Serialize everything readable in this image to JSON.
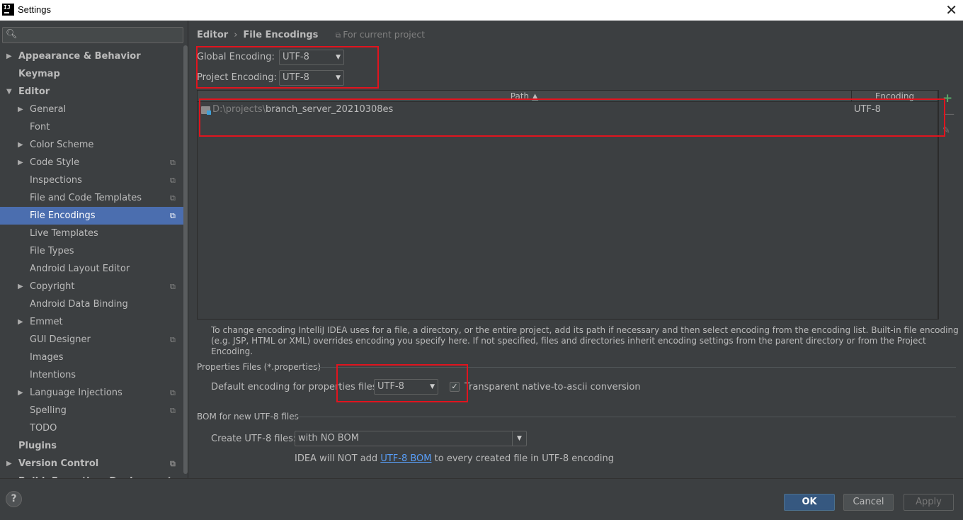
{
  "window": {
    "app_icon": "IJ",
    "title": "Settings",
    "close_icon": "✕"
  },
  "sidebar": {
    "search_placeholder": "",
    "items": [
      {
        "label": "Appearance & Behavior",
        "bold": true,
        "level": 0,
        "expandable": true,
        "expanded": false,
        "project": false
      },
      {
        "label": "Keymap",
        "bold": true,
        "level": 0,
        "expandable": false,
        "project": false
      },
      {
        "label": "Editor",
        "bold": true,
        "level": 0,
        "expandable": true,
        "expanded": true,
        "project": false
      },
      {
        "label": "General",
        "level": 1,
        "expandable": true,
        "expanded": false,
        "project": false
      },
      {
        "label": "Font",
        "level": 1,
        "expandable": false,
        "project": false
      },
      {
        "label": "Color Scheme",
        "level": 1,
        "expandable": true,
        "expanded": false,
        "project": false
      },
      {
        "label": "Code Style",
        "level": 1,
        "expandable": true,
        "expanded": false,
        "project": true
      },
      {
        "label": "Inspections",
        "level": 1,
        "expandable": false,
        "project": true
      },
      {
        "label": "File and Code Templates",
        "level": 1,
        "expandable": false,
        "project": true
      },
      {
        "label": "File Encodings",
        "level": 1,
        "expandable": false,
        "project": true,
        "selected": true
      },
      {
        "label": "Live Templates",
        "level": 1,
        "expandable": false,
        "project": false
      },
      {
        "label": "File Types",
        "level": 1,
        "expandable": false,
        "project": false
      },
      {
        "label": "Android Layout Editor",
        "level": 1,
        "expandable": false,
        "project": false
      },
      {
        "label": "Copyright",
        "level": 1,
        "expandable": true,
        "expanded": false,
        "project": true
      },
      {
        "label": "Android Data Binding",
        "level": 1,
        "expandable": false,
        "project": false
      },
      {
        "label": "Emmet",
        "level": 1,
        "expandable": true,
        "expanded": false,
        "project": false
      },
      {
        "label": "GUI Designer",
        "level": 1,
        "expandable": false,
        "project": true
      },
      {
        "label": "Images",
        "level": 1,
        "expandable": false,
        "project": false
      },
      {
        "label": "Intentions",
        "level": 1,
        "expandable": false,
        "project": false
      },
      {
        "label": "Language Injections",
        "level": 1,
        "expandable": true,
        "expanded": false,
        "project": true
      },
      {
        "label": "Spelling",
        "level": 1,
        "expandable": false,
        "project": true
      },
      {
        "label": "TODO",
        "level": 1,
        "expandable": false,
        "project": false
      },
      {
        "label": "Plugins",
        "bold": true,
        "level": 0,
        "expandable": false,
        "project": false
      },
      {
        "label": "Version Control",
        "bold": true,
        "level": 0,
        "expandable": true,
        "expanded": false,
        "project": true
      },
      {
        "label": "Build, Execution, Deployment",
        "bold": true,
        "level": 0,
        "expandable": true,
        "expanded": false,
        "project": false
      }
    ]
  },
  "breadcrumb": {
    "parent": "Editor",
    "separator": "›",
    "current": "File Encodings",
    "scope": "For current project"
  },
  "encodings": {
    "global_label": "Global Encoding:",
    "global_value": "UTF-8",
    "project_label": "Project Encoding:",
    "project_value": "UTF-8"
  },
  "table": {
    "columns": [
      "Path ▲",
      "Encoding"
    ],
    "rows": [
      {
        "path_prefix": "D:\\projects\\",
        "path_name": "branch_server_20210308es",
        "encoding": "UTF-8"
      }
    ],
    "add_icon": "+",
    "remove_icon": "—",
    "edit_icon": "✎"
  },
  "description": "To change encoding IntelliJ IDEA uses for a file, a directory, or the entire project, add its path if necessary and then select encoding from the encoding list. Built-in file encoding (e.g. JSP, HTML or XML) overrides encoding you specify here. If not specified, files and directories inherit encoding settings from the parent directory or from the Project Encoding.",
  "properties": {
    "section_title": "Properties Files (*.properties)",
    "default_label": "Default encoding for properties files:",
    "default_value": "UTF-8",
    "transparent_checked": true,
    "transparent_label": "Transparent native-to-ascii conversion"
  },
  "bom": {
    "section_title": "BOM for new UTF-8 files",
    "create_label": "Create UTF-8 files:",
    "create_value": "with NO BOM",
    "note_prefix": "IDEA will NOT add ",
    "note_link": "UTF-8 BOM",
    "note_suffix": " to every created file in UTF-8 encoding"
  },
  "footer": {
    "help": "?",
    "ok": "OK",
    "cancel": "Cancel",
    "apply": "Apply"
  },
  "colors": {
    "background": "#3c3f41",
    "selection": "#4b6eaf",
    "highlight_box": "#e0141e",
    "primary_button": "#365880",
    "link": "#589df6"
  }
}
